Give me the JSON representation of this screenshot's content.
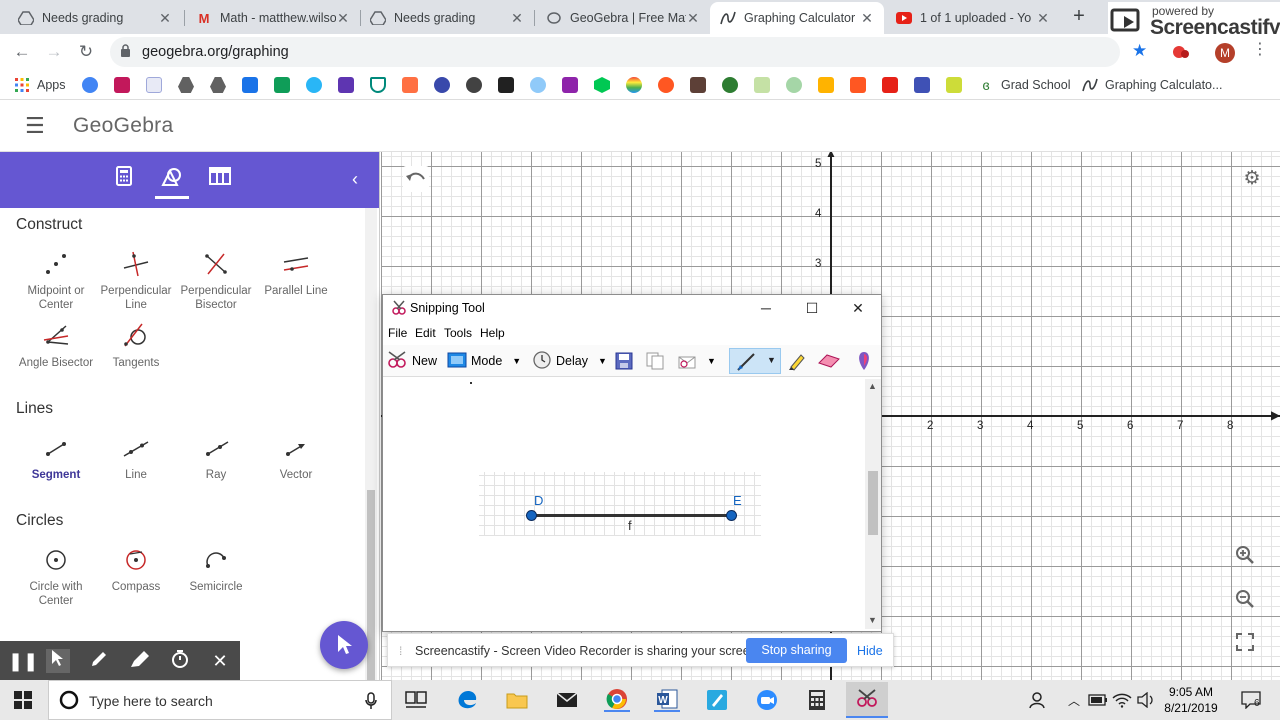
{
  "browser": {
    "tabs": [
      {
        "title": "Needs grading",
        "icon": "drive-icon"
      },
      {
        "title": "Math - matthew.wilso",
        "icon": "gmail-icon"
      },
      {
        "title": "Needs grading",
        "icon": "drive-icon"
      },
      {
        "title": "GeoGebra | Free Mat",
        "icon": "geogebra-icon"
      },
      {
        "title": "Graphing Calculator",
        "icon": "graphing-icon",
        "active": true
      },
      {
        "title": "1 of 1 uploaded - Yo",
        "icon": "youtube-icon"
      }
    ],
    "url": "geogebra.org/graphing",
    "bookmarks": {
      "apps": "Apps",
      "grad_school": "Grad School",
      "graphing": "Graphing Calculato..."
    },
    "profile_initial": "M"
  },
  "screencastify_badge": {
    "powered_by": "powered by",
    "name": "Screencastify"
  },
  "geogebra": {
    "logo": "GeoGebra",
    "categories": {
      "construct": "Construct",
      "lines": "Lines",
      "circles": "Circles"
    },
    "tools": {
      "midpoint": "Midpoint or Center",
      "perpendicular_line": "Perpendicular Line",
      "perpendicular_bisector": "Perpendicular Bisector",
      "parallel_line": "Parallel Line",
      "angle_bisector": "Angle Bisector",
      "tangents": "Tangents",
      "segment": "Segment",
      "line": "Line",
      "ray": "Ray",
      "vector": "Vector",
      "circle_center": "Circle with Center",
      "compass": "Compass",
      "semicircle": "Semicircle"
    },
    "selected_tool": "Segment",
    "axes": {
      "y_ticks": [
        "5",
        "4",
        "3"
      ],
      "x_ticks": [
        "2",
        "3",
        "4",
        "5",
        "6",
        "7",
        "8"
      ]
    }
  },
  "snipping_tool": {
    "title": "Snipping Tool",
    "menu": {
      "file": "File",
      "edit": "Edit",
      "tools": "Tools",
      "help": "Help"
    },
    "buttons": {
      "new": "New",
      "mode": "Mode",
      "delay": "Delay"
    },
    "capture": {
      "point_d": "D",
      "point_e": "E",
      "segment": "f"
    }
  },
  "screencastify_bar": {
    "message": "Screencastify - Screen Video Recorder is sharing your screen.",
    "stop": "Stop sharing",
    "hide": "Hide"
  },
  "taskbar": {
    "search_placeholder": "Type here to search",
    "time": "9:05 AM",
    "date": "8/21/2019",
    "notifications": "6"
  },
  "colors": {
    "geogebra_purple": "#6557d2",
    "point_blue": "#1565c0",
    "stop_button": "#4a86f0"
  }
}
